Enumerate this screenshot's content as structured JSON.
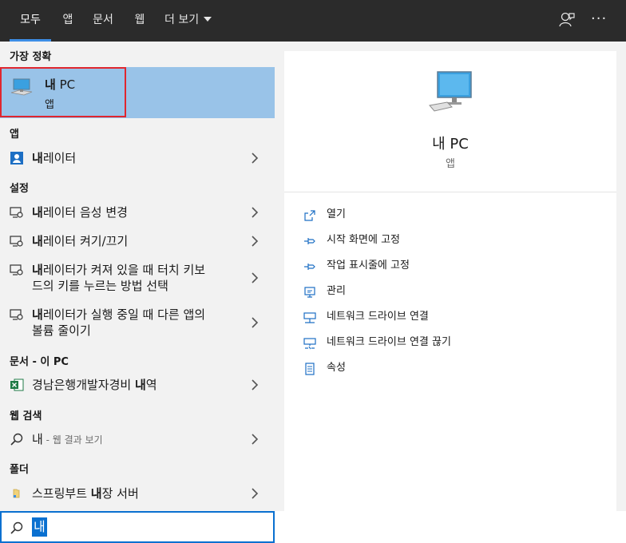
{
  "tabs": [
    {
      "label": "모두"
    },
    {
      "label": "앱"
    },
    {
      "label": "문서"
    },
    {
      "label": "웹"
    },
    {
      "label": "더 보기"
    }
  ],
  "sections": {
    "best_match": "가장 정확",
    "apps": "앱",
    "settings": "설정",
    "documents": "문서 - 이 PC",
    "web": "웹 검색",
    "folders": "폴더"
  },
  "best_match": {
    "title_bold": "내",
    "title_rest": " PC",
    "subtitle": "앱"
  },
  "results": {
    "narrator": {
      "bold": "내",
      "rest": "레이터"
    },
    "narrator_voice": {
      "bold": "내",
      "rest": "레이터 음성 변경"
    },
    "narrator_toggle": {
      "bold": "내",
      "rest": "레이터 켜기/끄기"
    },
    "narrator_keys": {
      "bold": "내",
      "rest1": "레이터가 켜져 있을 때 터치 키보",
      "line2": "드의 키를 누르는 방법 선택"
    },
    "narrator_running": {
      "bold": "내",
      "rest1": "레이터가 실행 중일 때 다른 앱의",
      "line2": "볼륨 줄이기"
    },
    "document": {
      "pre": "경남은행개발자경비 ",
      "bold": "내",
      "post": "역"
    },
    "web_search": {
      "term": "내",
      "suffix": " - 웹 결과 보기"
    },
    "folder": {
      "pre": "스프링부트 ",
      "bold": "내",
      "post": "장 서버"
    }
  },
  "search": {
    "query": "내"
  },
  "detail": {
    "title": "내 PC",
    "subtitle": "앱",
    "actions": [
      "열기",
      "시작 화면에 고정",
      "작업 표시줄에 고정",
      "관리",
      "네트워크 드라이브 연결",
      "네트워크 드라이브 연결 끊기",
      "속성"
    ]
  },
  "colors": {
    "accent": "#0a70d0",
    "selection": "#99c3e8",
    "highlight_border": "#e0262e",
    "topbar": "#2b2b2b",
    "panel": "#f2f2f2"
  },
  "icons": [
    "computer-icon",
    "narrator-icon",
    "settings-narrator-icon",
    "excel-icon",
    "search-icon",
    "folder-icon",
    "chevron-right-icon",
    "feedback-icon",
    "more-icon",
    "open-icon",
    "pin-icon",
    "manage-icon",
    "network-drive-icon",
    "properties-icon"
  ]
}
